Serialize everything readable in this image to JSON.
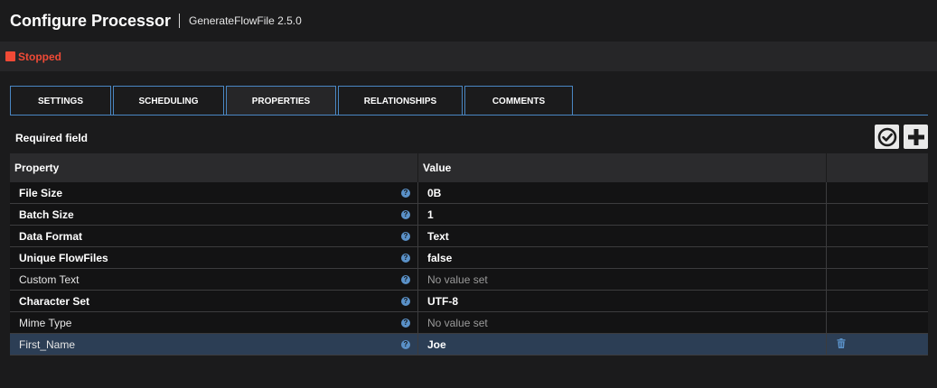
{
  "header": {
    "title": "Configure Processor",
    "subtitle": "GenerateFlowFile 2.5.0"
  },
  "status": {
    "label": "Stopped",
    "color": "#f04a36"
  },
  "tabs": [
    {
      "label": "SETTINGS"
    },
    {
      "label": "SCHEDULING"
    },
    {
      "label": "PROPERTIES",
      "active": true
    },
    {
      "label": "RELATIONSHIPS"
    },
    {
      "label": "COMMENTS"
    }
  ],
  "required_label": "Required field",
  "toolbar": {
    "verify_icon": "check-circle-icon",
    "add_icon": "plus-icon"
  },
  "table": {
    "headers": {
      "property": "Property",
      "value": "Value"
    },
    "rows": [
      {
        "property": "File Size",
        "value": "0B",
        "required": true,
        "hasValue": true
      },
      {
        "property": "Batch Size",
        "value": "1",
        "required": true,
        "hasValue": true
      },
      {
        "property": "Data Format",
        "value": "Text",
        "required": true,
        "hasValue": true
      },
      {
        "property": "Unique FlowFiles",
        "value": "false",
        "required": true,
        "hasValue": true
      },
      {
        "property": "Custom Text",
        "value": "No value set",
        "required": false,
        "hasValue": false
      },
      {
        "property": "Character Set",
        "value": "UTF-8",
        "required": true,
        "hasValue": true
      },
      {
        "property": "Mime Type",
        "value": "No value set",
        "required": false,
        "hasValue": false
      },
      {
        "property": "First_Name",
        "value": "Joe",
        "required": false,
        "hasValue": true,
        "selected": true,
        "deletable": true
      }
    ]
  },
  "colors": {
    "accent": "#4a87c4",
    "help": "#5a91c8",
    "selected_row": "#2c3e55"
  }
}
